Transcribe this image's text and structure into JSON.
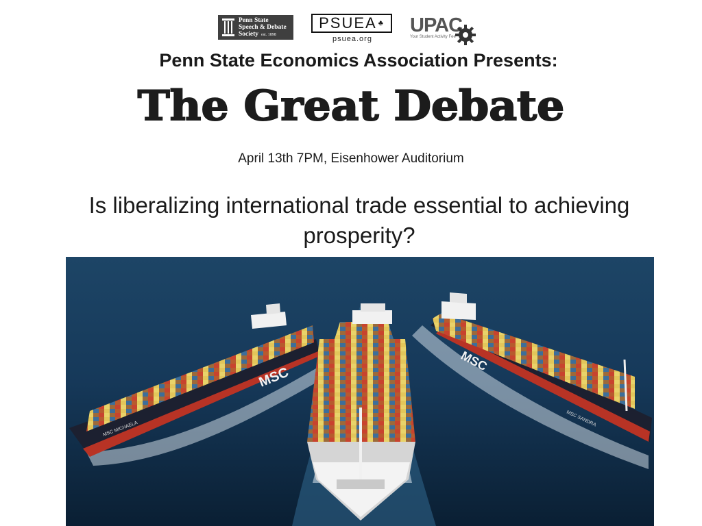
{
  "logos": {
    "speech_debate": {
      "line1": "Penn State",
      "line2": "Speech & Debate",
      "line3": "Society",
      "est": "est. 1898"
    },
    "psuea": {
      "name": "PSUEA",
      "url": "psuea.org"
    },
    "upac": {
      "name": "UPAC",
      "tagline": "Your Student Activity Fee"
    }
  },
  "presenter": "Penn State Economics Association Presents:",
  "title": "The Great Debate",
  "date_location": "April 13th 7PM, Eisenhower Auditorium",
  "question": "Is liberalizing international trade essential to achieving prosperity?",
  "photo": {
    "ship_left_name": "MSC MICHAELA",
    "ship_right_name": "MSC SANDRA",
    "hull_brand": "MSC",
    "colors": {
      "sea": "#0d2a45",
      "hull": "#1c2030",
      "stripe": "#b83325",
      "wake": "#e6eef4"
    }
  }
}
